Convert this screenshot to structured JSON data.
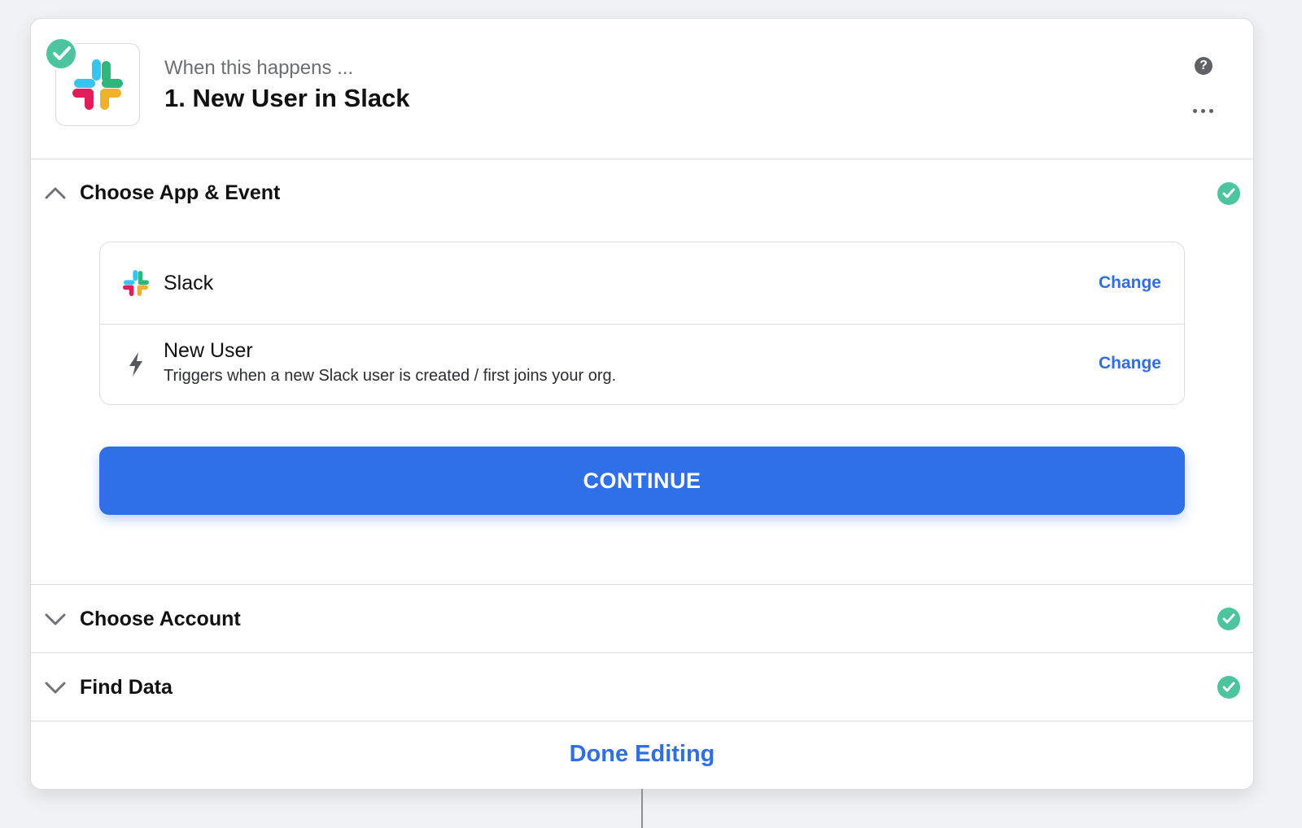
{
  "header": {
    "eyebrow": "When this happens ...",
    "title": "1. New User in Slack",
    "app_icon": "slack-logo",
    "status_icon": "check-icon",
    "help_icon_glyph": "?"
  },
  "sections": {
    "app_event": {
      "title": "Choose App & Event",
      "expanded": true,
      "app_row": {
        "label": "Slack",
        "change_label": "Change"
      },
      "event_row": {
        "label": "New User",
        "description": "Triggers when a new Slack user is created / first joins your org.",
        "change_label": "Change",
        "icon": "bolt-icon"
      },
      "continue_label": "CONTINUE"
    },
    "account": {
      "title": "Choose Account",
      "expanded": false
    },
    "find_data": {
      "title": "Find Data",
      "expanded": false
    }
  },
  "footer": {
    "done_label": "Done Editing"
  },
  "colors": {
    "accent": "#2f6fe8",
    "link": "#2f6fe3",
    "success": "#4cc59e",
    "slack_blue": "#36c5f0",
    "slack_green": "#2eb67d",
    "slack_red": "#e01e5a",
    "slack_yellow": "#ecb22e"
  }
}
